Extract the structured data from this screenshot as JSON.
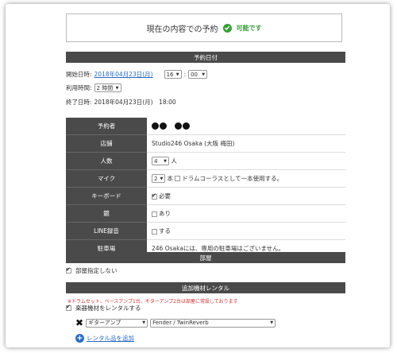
{
  "status": {
    "title": "現在の内容での予約",
    "ok_label": "可能です"
  },
  "sections": {
    "date": "予約日付",
    "room": "部屋",
    "rental": "追加機材レンタル"
  },
  "date": {
    "start_label": "開始日時:",
    "start_date": "2018年04月23日(月)",
    "hour": "16",
    "colon": ":",
    "minute": "00",
    "duration_label": "利用時間:",
    "duration": "2 時間",
    "end_label": "終了日時:",
    "end_value": "2018年04月23日(月)　18:00"
  },
  "info": {
    "reserver_label": "予約者",
    "store_label": "店舗",
    "store_value": "Studio246 Osaka (大阪 梅田)",
    "people_label": "人数",
    "people_value": "4",
    "people_unit": "人",
    "mic_label": "マイク",
    "mic_value": "2",
    "mic_unit": "本",
    "mic_option": "ドラムコーラスとして一本使用する。",
    "keyboard_label": "キーボード",
    "keyboard_value": "必要",
    "drum_label": "鏡",
    "drum_value": "あり",
    "line_label": "LINE録音",
    "line_value": "する",
    "parking_label": "駐車場",
    "parking_value": "246 Osakaには、専用の駐車場はございません。"
  },
  "room": {
    "no_room": "部屋指定しない"
  },
  "rental": {
    "note": "※ドラムセット、ベースアンプ1台、ギターアンプ2台は部屋に常設しております",
    "rent_check": "楽器機材をレンタルする",
    "category": "ギターアンプ",
    "model": "Fender / TwinReverb",
    "add_link": "レンタル品を追加"
  },
  "colors": {
    "bar": "#4a4a4a",
    "ok": "#3a9d3a",
    "link": "#2a6cc2",
    "note": "#d03030"
  }
}
